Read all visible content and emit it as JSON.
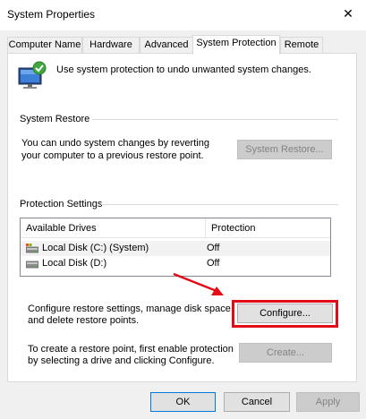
{
  "window": {
    "title": "System Properties"
  },
  "tabs": [
    {
      "label": "Computer Name",
      "active": false
    },
    {
      "label": "Hardware",
      "active": false
    },
    {
      "label": "Advanced",
      "active": false
    },
    {
      "label": "System Protection",
      "active": true
    },
    {
      "label": "Remote",
      "active": false
    }
  ],
  "intro": {
    "text": "Use system protection to undo unwanted system changes."
  },
  "system_restore": {
    "label": "System Restore",
    "description_line1": "You can undo system changes by reverting",
    "description_line2": "your computer to a previous restore point.",
    "button_label": "System Restore..."
  },
  "protection_settings": {
    "label": "Protection Settings",
    "columns": [
      "Available Drives",
      "Protection"
    ],
    "drives": [
      {
        "name": "Local Disk (C:) (System)",
        "protection": "Off",
        "selected": true,
        "icon": "system-drive-icon"
      },
      {
        "name": "Local Disk (D:)",
        "protection": "Off",
        "selected": false,
        "icon": "drive-icon"
      }
    ],
    "configure_line1": "Configure restore settings, manage disk space,",
    "configure_line2": "and delete restore points.",
    "configure_button": "Configure...",
    "create_line1": "To create a restore point, first enable protection",
    "create_line2": "by selecting a drive and clicking Configure.",
    "create_button": "Create..."
  },
  "footer": {
    "ok": "OK",
    "cancel": "Cancel",
    "apply": "Apply"
  },
  "colors": {
    "highlight": "#e30b17",
    "accent": "#0078d7"
  }
}
